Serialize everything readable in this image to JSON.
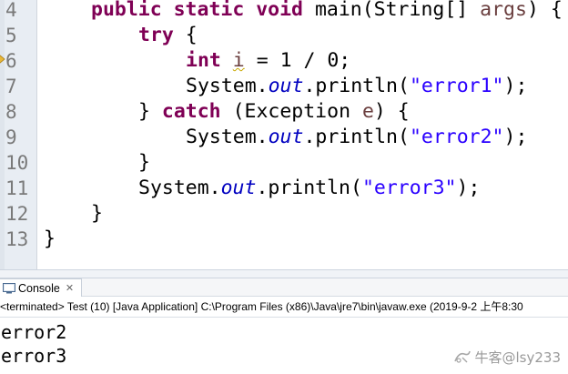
{
  "editor": {
    "line_numbers": [
      "4",
      "5",
      "6",
      "7",
      "8",
      "9",
      "10",
      "11",
      "12",
      "13"
    ],
    "code": {
      "l4_kw": "public static void",
      "l4_mid": " main(String[] ",
      "l4_param": "args",
      "l4_end": ") {",
      "l5_kw": "try",
      "l5_end": " {",
      "l6_kw": "int",
      "l6_sp": " ",
      "l6_var": "i",
      "l6_rest": " = 1 / 0;",
      "l7_a": "System.",
      "l7_field": "out",
      "l7_b": ".println(",
      "l7_str": "\"error1\"",
      "l7_c": ");",
      "l8_a": "} ",
      "l8_kw": "catch",
      "l8_b": " (Exception ",
      "l8_var": "e",
      "l8_c": ") {",
      "l9_a": "System.",
      "l9_field": "out",
      "l9_b": ".println(",
      "l9_str": "\"error2\"",
      "l9_c": ");",
      "l10": "}",
      "l11_a": "System.",
      "l11_field": "out",
      "l11_b": ".println(",
      "l11_str": "\"error3\"",
      "l11_c": ");",
      "l12": "}",
      "l13": "}"
    },
    "colors": {
      "keyword": "#7f0055",
      "string": "#2a00ff",
      "static_field": "#0000c0",
      "local_variable": "#6a3e3e",
      "warning_underline": "#c8a800"
    }
  },
  "console": {
    "tab_label": "Console",
    "tab_close_glyph": "✕",
    "tab_icon": "console-monitor-icon",
    "header": "<terminated> Test (10) [Java Application] C:\\Program Files (x86)\\Java\\jre7\\bin\\javaw.exe (2019-9-2 上午8:30",
    "output": [
      "error2",
      "error3"
    ]
  },
  "watermark": {
    "text": "牛客@lsy233",
    "icon": "nowcoder-logo-icon"
  }
}
